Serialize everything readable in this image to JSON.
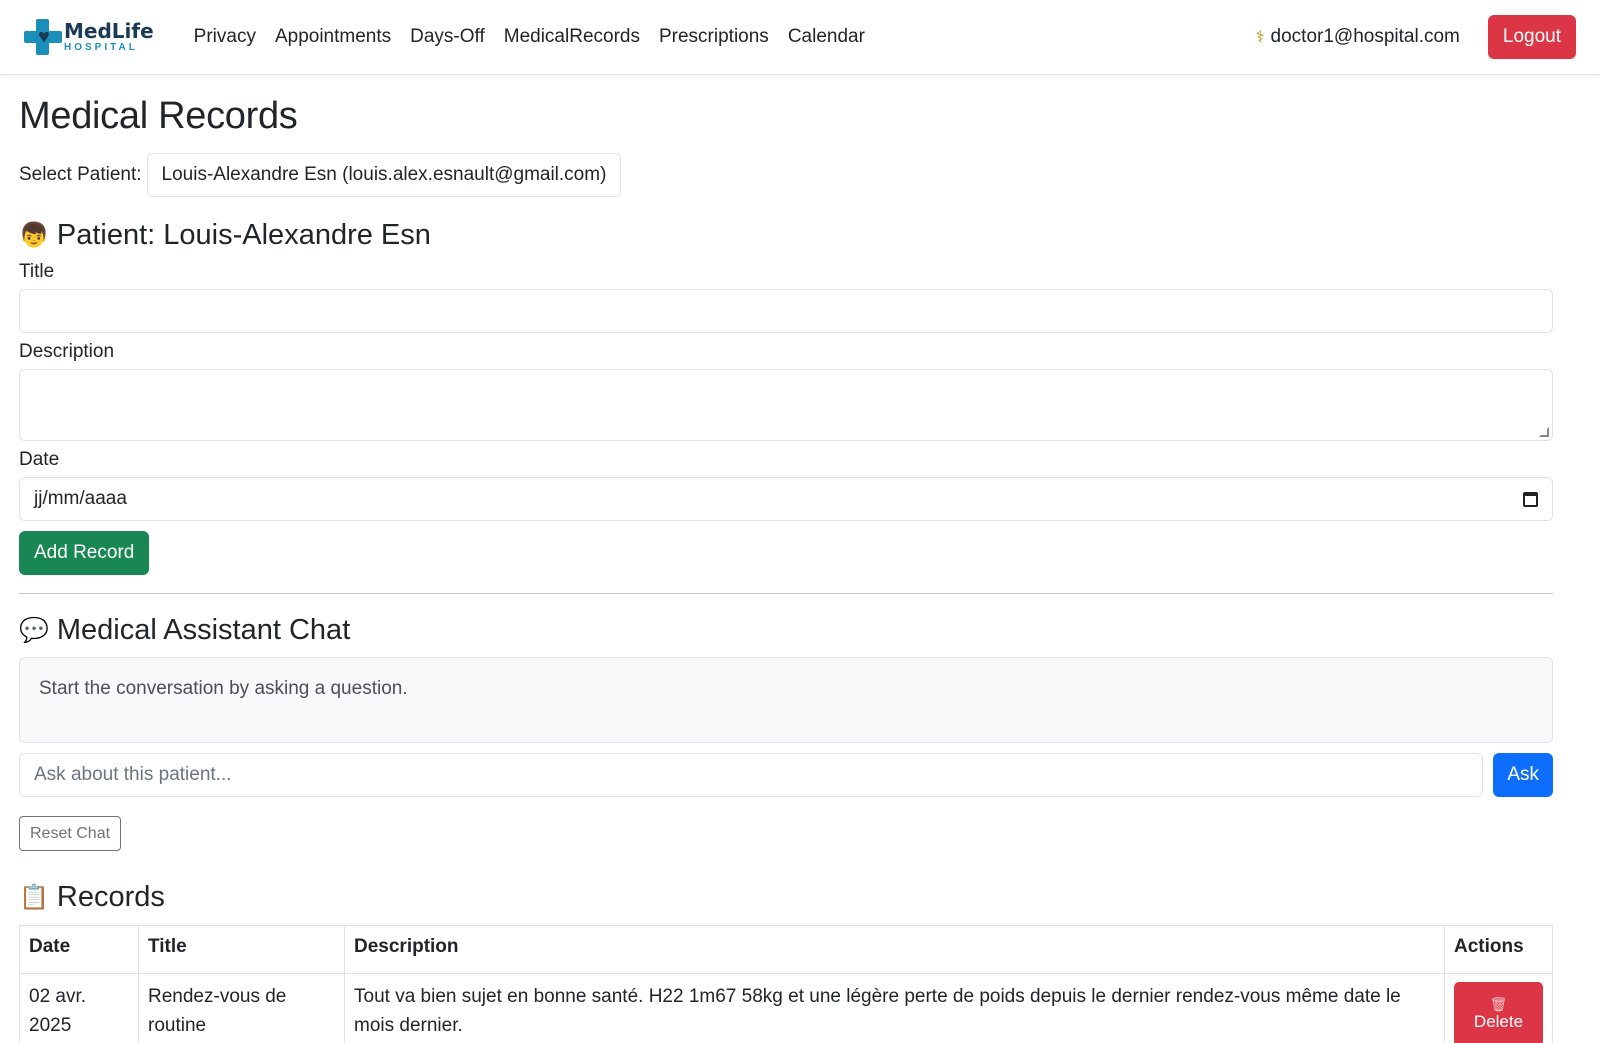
{
  "brand": {
    "name": "MedLife",
    "sub": "HOSPITAL"
  },
  "nav": {
    "links": [
      "Privacy",
      "Appointments",
      "Days-Off",
      "MedicalRecords",
      "Prescriptions",
      "Calendar"
    ],
    "user_email": "doctor1@hospital.com",
    "logout_label": "Logout"
  },
  "page": {
    "title": "Medical Records",
    "select_label": "Select Patient:",
    "selected_patient": "Louis-Alexandre Esn (louis.alex.esnault@gmail.com)",
    "patient_heading": "Patient: Louis-Alexandre Esn"
  },
  "form": {
    "title_label": "Title",
    "title_value": "",
    "description_label": "Description",
    "description_value": "",
    "date_label": "Date",
    "date_placeholder": "jj/mm/aaaa",
    "submit_label": "Add Record"
  },
  "chat": {
    "heading": "Medical Assistant Chat",
    "empty_message": "Start the conversation by asking a question.",
    "input_placeholder": "Ask about this patient...",
    "ask_label": "Ask",
    "reset_label": "Reset Chat"
  },
  "records": {
    "heading": "Records",
    "columns": [
      "Date",
      "Title",
      "Description",
      "Actions"
    ],
    "rows": [
      {
        "date": "02 avr. 2025",
        "title": "Rendez-vous de routine",
        "description": "Tout va bien sujet en bonne santé. H22 1m67 58kg et une légère perte de poids depuis le dernier rendez-vous même date le mois dernier.",
        "delete_label": "Delete"
      }
    ]
  },
  "icons": {
    "user": "doctor-icon",
    "patient": "person-icon",
    "chat": "speech-bubble-icon",
    "records": "clipboard-icon",
    "delete": "trash-icon"
  },
  "colors": {
    "danger": "#dc3545",
    "success": "#198754",
    "primary": "#0d6efd",
    "brand": "#1a8fb8"
  }
}
